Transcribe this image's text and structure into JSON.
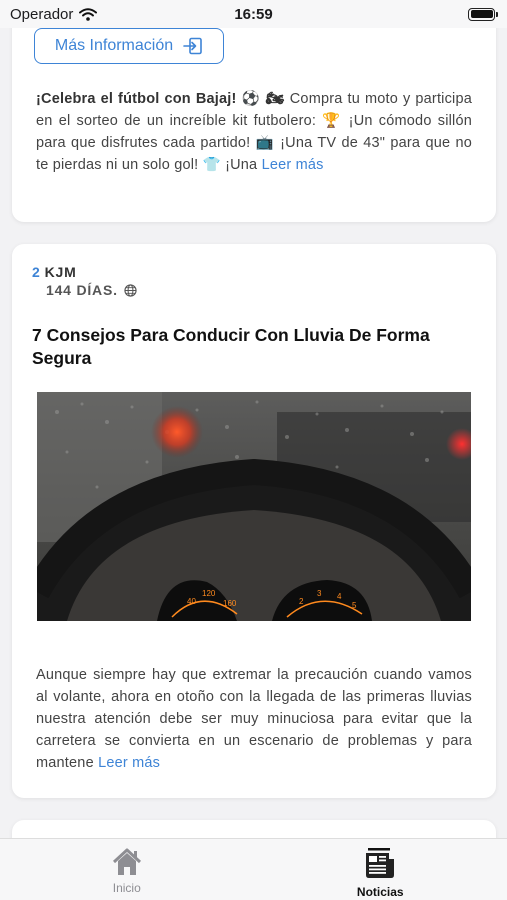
{
  "status_bar": {
    "carrier": "Operador",
    "time": "16:59"
  },
  "feed": {
    "post1": {
      "button_label": "Más Información",
      "text_bold": "¡Celebra el fútbol con Bajaj! ⚽ 🏍",
      "text_body": " Compra tu moto y participa en el sorteo de un increíble kit futbolero: 🏆 ¡Un cómodo sillón para que disfrutes cada partido! 📺 ¡Una TV de 43\" para que no te pierdas ni un solo gol! 👕 ¡Una ",
      "read_more": "Leer más"
    },
    "post2": {
      "count": "2",
      "author": "KJM",
      "age": "144 DÍAS.",
      "title": "7 Consejos Para Conducir Con Lluvia De Forma Segura",
      "body": "Aunque siempre hay que extremar la precaución cuando vamos al volante, ahora en otoño con la llegada de las primeras lluvias nuestra atención debe ser muy minuciosa para evitar que la carretera se convierta en un escenario de problemas y para mantene ",
      "read_more": "Leer más"
    }
  },
  "tab_bar": {
    "tabs": [
      {
        "label": "Inicio",
        "icon": "home-icon",
        "active": false
      },
      {
        "label": "Noticias",
        "icon": "newspaper-icon",
        "active": true
      }
    ]
  },
  "colors": {
    "accent": "#3e84d6",
    "background": "#f2f2f4"
  }
}
